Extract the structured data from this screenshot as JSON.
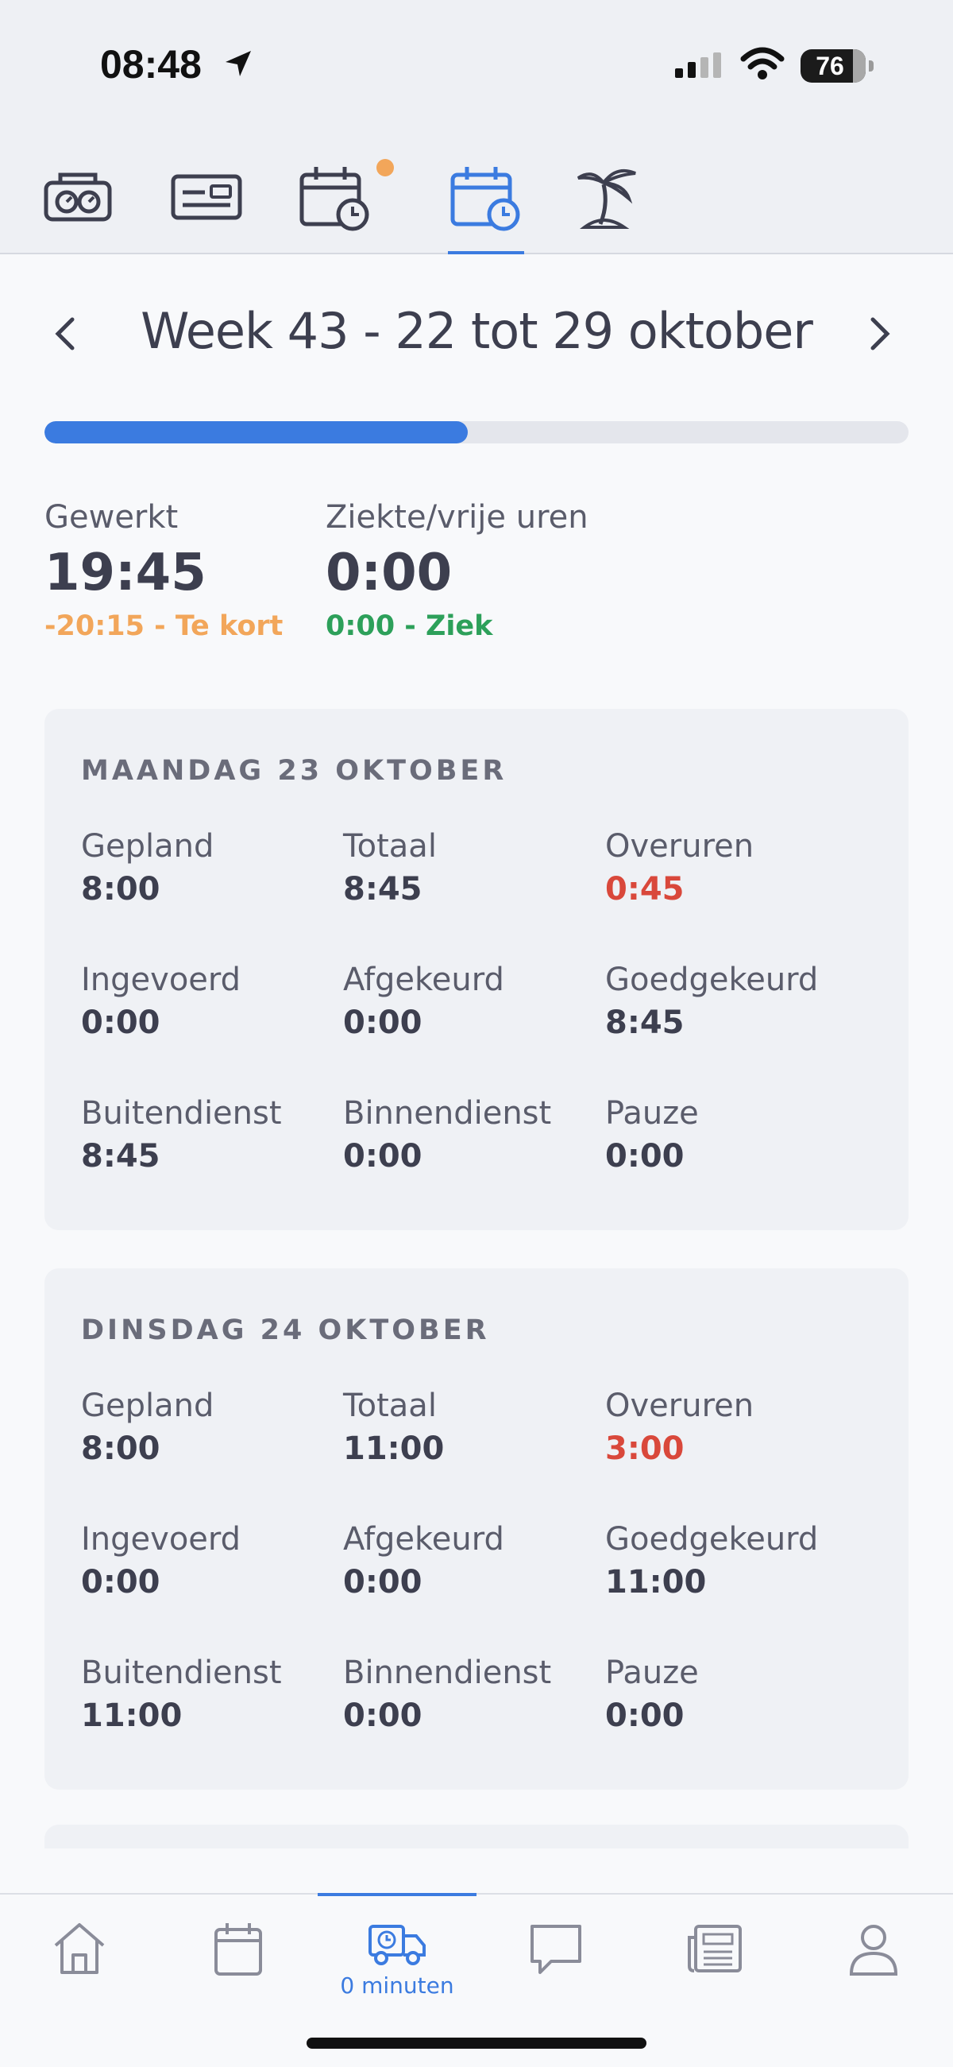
{
  "status_bar": {
    "time": "08:48",
    "battery": "76"
  },
  "top_tabs": [
    {
      "name": "tab-timeclock",
      "icon": "time-clock-icon",
      "active": false
    },
    {
      "name": "tab-card",
      "icon": "id-card-icon",
      "active": false
    },
    {
      "name": "tab-schedule-notify",
      "icon": "calendar-clock-icon",
      "active": false,
      "badge": true
    },
    {
      "name": "tab-hours",
      "icon": "calendar-clock-icon",
      "active": true
    },
    {
      "name": "tab-vacation",
      "icon": "palm-tree-icon",
      "active": false
    }
  ],
  "week": {
    "title": "Week 43 - 22 tot 29 oktober",
    "progress": 0.49
  },
  "summary": {
    "worked": {
      "label": "Gewerkt",
      "value": "19:45",
      "sub": "-20:15 - Te kort"
    },
    "sick": {
      "label": "Ziekte/vrije uren",
      "value": "0:00",
      "sub": "0:00 - Ziek"
    }
  },
  "days": [
    {
      "title": "MAANDAG 23 OKTOBER",
      "cells": [
        {
          "label": "Gepland",
          "value": "8:00"
        },
        {
          "label": "Totaal",
          "value": "8:45"
        },
        {
          "label": "Overuren",
          "value": "0:45"
        },
        {
          "label": "Ingevoerd",
          "value": "0:00"
        },
        {
          "label": "Afgekeurd",
          "value": "0:00"
        },
        {
          "label": "Goedgekeurd",
          "value": "8:45"
        },
        {
          "label": "Buitendienst",
          "value": "8:45"
        },
        {
          "label": "Binnendienst",
          "value": "0:00"
        },
        {
          "label": "Pauze",
          "value": "0:00"
        }
      ]
    },
    {
      "title": "DINSDAG 24 OKTOBER",
      "cells": [
        {
          "label": "Gepland",
          "value": "8:00"
        },
        {
          "label": "Totaal",
          "value": "11:00"
        },
        {
          "label": "Overuren",
          "value": "3:00"
        },
        {
          "label": "Ingevoerd",
          "value": "0:00"
        },
        {
          "label": "Afgekeurd",
          "value": "0:00"
        },
        {
          "label": "Goedgekeurd",
          "value": "11:00"
        },
        {
          "label": "Buitendienst",
          "value": "11:00"
        },
        {
          "label": "Binnendienst",
          "value": "0:00"
        },
        {
          "label": "Pauze",
          "value": "0:00"
        }
      ]
    }
  ],
  "bottom_nav": {
    "active_label": "0 minuten",
    "items": [
      "home-icon",
      "calendar-icon",
      "truck-clock-icon",
      "chat-icon",
      "news-icon",
      "user-icon"
    ]
  },
  "colors": {
    "accent": "#3b7be0",
    "warning": "#f2a65a",
    "success": "#2da05a",
    "overtime": "#d9483b"
  }
}
